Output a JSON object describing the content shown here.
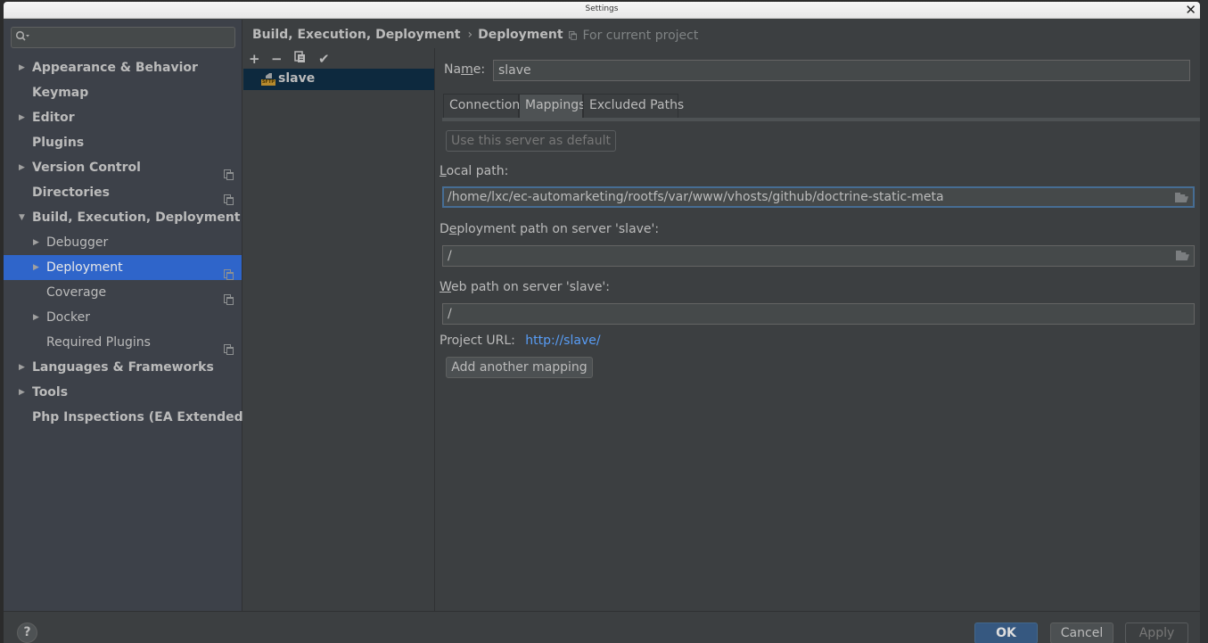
{
  "window": {
    "title": "Settings",
    "close_icon": "✕"
  },
  "search": {
    "placeholder": "",
    "icon": "search-icon"
  },
  "sidebar": {
    "items": [
      {
        "label": "Appearance & Behavior",
        "level": 0,
        "arrow": "▶",
        "project": false
      },
      {
        "label": "Keymap",
        "level": 0,
        "arrow": "",
        "project": false
      },
      {
        "label": "Editor",
        "level": 0,
        "arrow": "▶",
        "project": false
      },
      {
        "label": "Plugins",
        "level": 0,
        "arrow": "",
        "project": false
      },
      {
        "label": "Version Control",
        "level": 0,
        "arrow": "▶",
        "project": true
      },
      {
        "label": "Directories",
        "level": 0,
        "arrow": "",
        "project": true
      },
      {
        "label": "Build, Execution, Deployment",
        "level": 0,
        "arrow": "▼",
        "project": false
      },
      {
        "label": "Debugger",
        "level": 1,
        "arrow": "▶",
        "project": false
      },
      {
        "label": "Deployment",
        "level": 1,
        "arrow": "▶",
        "project": true,
        "selected": true
      },
      {
        "label": "Coverage",
        "level": 1,
        "arrow": "",
        "project": true
      },
      {
        "label": "Docker",
        "level": 1,
        "arrow": "▶",
        "project": false
      },
      {
        "label": "Required Plugins",
        "level": 1,
        "arrow": "",
        "project": true
      },
      {
        "label": "Languages & Frameworks",
        "level": 0,
        "arrow": "▶",
        "project": false
      },
      {
        "label": "Tools",
        "level": 0,
        "arrow": "▶",
        "project": false
      },
      {
        "label": "Php Inspections (EA Extended)",
        "level": 0,
        "arrow": "",
        "project": false
      }
    ]
  },
  "breadcrumb": {
    "parent": "Build, Execution, Deployment",
    "separator": "›",
    "current": "Deployment",
    "scope": "For current project"
  },
  "servers": {
    "toolbar": {
      "add": "+",
      "remove": "−",
      "copy": "⧉",
      "default": "✔"
    },
    "list": [
      {
        "name": "slave",
        "type_badge": "SFTP"
      }
    ]
  },
  "details": {
    "name_label_pre": "Na",
    "name_label_mn": "m",
    "name_label_post": "e:",
    "name_value": "slave",
    "tabs": [
      {
        "label": "Connection",
        "active": false
      },
      {
        "label": "Mappings",
        "active": true
      },
      {
        "label": "Excluded Paths",
        "active": false
      }
    ],
    "use_default_button": "Use this server as default",
    "local_path_label_mn": "L",
    "local_path_label_rest": "ocal path:",
    "local_path_value": "/home/lxc/ec-automarketing/rootfs/var/www/vhosts/github/doctrine-static-meta",
    "deploy_path_label_pre": "D",
    "deploy_path_label_mn": "e",
    "deploy_path_label_post": "ployment path on server 'slave':",
    "deploy_path_value": "/",
    "web_path_label_mn": "W",
    "web_path_label_rest": "eb path on server 'slave':",
    "web_path_value": "/",
    "project_url_label": "Project URL:",
    "project_url_value": "http://slave/",
    "add_mapping_button": "Add another mapping"
  },
  "footer": {
    "help": "?",
    "ok": "OK",
    "cancel": "Cancel",
    "apply": "Apply"
  },
  "colors": {
    "selection": "#2f65ca",
    "server_selection": "#0d293e",
    "link": "#589df6",
    "ok_button": "#365880",
    "focus_border": "#466d94"
  }
}
